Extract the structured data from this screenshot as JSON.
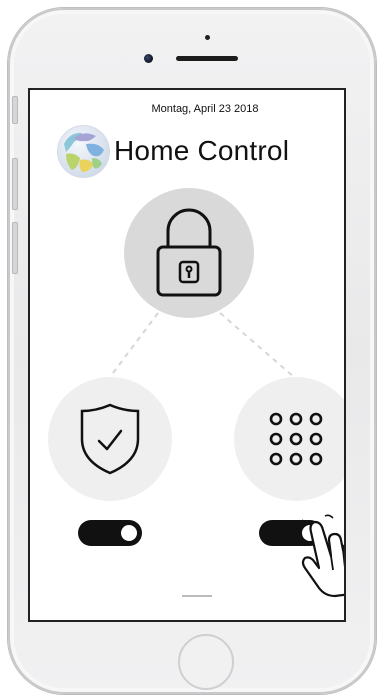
{
  "app": {
    "date": "Montag, April 23 2018",
    "title": "Home Control"
  },
  "controls": [
    {
      "id": "lock",
      "icon": "lock-icon",
      "label": "",
      "active": null
    },
    {
      "id": "shield",
      "icon": "shield-check-icon",
      "toggle_on": true
    },
    {
      "id": "keypad",
      "icon": "keypad-icon",
      "toggle_on": true
    }
  ],
  "colors": {
    "accent": "#111111",
    "lock_circle": "#d9d9d9",
    "control_circle": "#efefef",
    "screen_bg": "#ffffff"
  }
}
